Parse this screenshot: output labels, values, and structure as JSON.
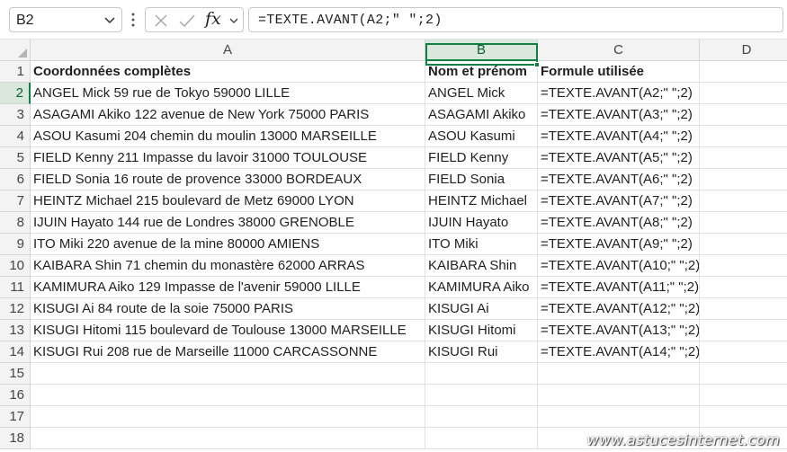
{
  "formula_bar": {
    "name_box": "B2",
    "fx_label": "fx",
    "formula": "=TEXTE.AVANT(A2;\" \";2)"
  },
  "columns": [
    "A",
    "B",
    "C",
    "D"
  ],
  "rows": [
    "1",
    "2",
    "3",
    "4",
    "5",
    "6",
    "7",
    "8",
    "9",
    "10",
    "11",
    "12",
    "13",
    "14",
    "15",
    "16",
    "17",
    "18"
  ],
  "header_row": {
    "a": "Coordonnées complètes",
    "b": "Nom et prénom",
    "c": "Formule utilisée"
  },
  "data_rows": [
    {
      "a": "ANGEL Mick 59 rue de Tokyo 59000 LILLE",
      "b": "ANGEL Mick",
      "c": "=TEXTE.AVANT(A2;\" \";2)"
    },
    {
      "a": "ASAGAMI Akiko 122 avenue de New York 75000 PARIS",
      "b": "ASAGAMI Akiko",
      "c": "=TEXTE.AVANT(A3;\" \";2)"
    },
    {
      "a": "ASOU Kasumi 204 chemin du moulin 13000 MARSEILLE",
      "b": "ASOU Kasumi",
      "c": "=TEXTE.AVANT(A4;\" \";2)"
    },
    {
      "a": "FIELD Kenny 211 Impasse du lavoir 31000 TOULOUSE",
      "b": "FIELD Kenny",
      "c": "=TEXTE.AVANT(A5;\" \";2)"
    },
    {
      "a": "FIELD Sonia 16 route de provence 33000 BORDEAUX",
      "b": "FIELD Sonia",
      "c": "=TEXTE.AVANT(A6;\" \";2)"
    },
    {
      "a": "HEINTZ Michael 215 boulevard de Metz 69000 LYON",
      "b": "HEINTZ Michael",
      "c": "=TEXTE.AVANT(A7;\" \";2)"
    },
    {
      "a": "IJUIN Hayato  144 rue de Londres 38000 GRENOBLE",
      "b": "IJUIN Hayato",
      "c": "=TEXTE.AVANT(A8;\" \";2)"
    },
    {
      "a": "ITO Miki 220 avenue de la mine 80000 AMIENS",
      "b": "ITO Miki",
      "c": "=TEXTE.AVANT(A9;\" \";2)"
    },
    {
      "a": "KAIBARA Shin 71 chemin du monastère 62000 ARRAS",
      "b": "KAIBARA Shin",
      "c": "=TEXTE.AVANT(A10;\" \";2)"
    },
    {
      "a": "KAMIMURA Aiko 129 Impasse de l'avenir 59000 LILLE",
      "b": "KAMIMURA Aiko",
      "c": "=TEXTE.AVANT(A11;\" \";2)"
    },
    {
      "a": "KISUGI Ai 84 route de la soie 75000 PARIS",
      "b": "KISUGI Ai",
      "c": "=TEXTE.AVANT(A12;\" \";2)"
    },
    {
      "a": "KISUGI Hitomi 115 boulevard de Toulouse 13000 MARSEILLE",
      "b": "KISUGI Hitomi",
      "c": "=TEXTE.AVANT(A13;\" \";2)"
    },
    {
      "a": "KISUGI Rui 208 rue de Marseille 11000 CARCASSONNE",
      "b": "KISUGI Rui",
      "c": "=TEXTE.AVANT(A14;\" \";2)"
    }
  ],
  "selection": {
    "cell": "B2",
    "accent_color": "#137e43"
  },
  "watermark": "www.astucesinternet.com"
}
